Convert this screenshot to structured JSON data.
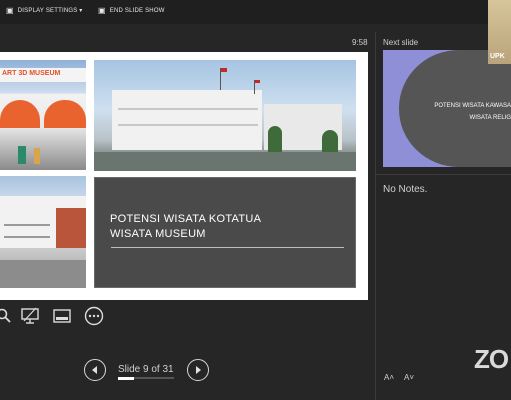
{
  "toolbar": {
    "display_settings_label": "DISPLAY SETTINGS ▾",
    "end_slideshow_label": "END SLIDE SHOW"
  },
  "timer": {
    "time": "9:58"
  },
  "slide": {
    "title_line1": "POTENSI WISATA KOTATUA",
    "title_line2": "WISATA MUSEUM",
    "photo_sign_text": "ART 3D MUSEUM"
  },
  "next_slide": {
    "header": "Next slide",
    "text_line1": "POTENSI WISATA KAWASA",
    "text_line2": "WISATA RELIG"
  },
  "notes": {
    "text": "No Notes."
  },
  "notes_font": {
    "increase": "A˄",
    "decrease": "A˅"
  },
  "navigation": {
    "counter": "Slide 9 of 31",
    "current": 9,
    "total": 31
  },
  "webcam": {
    "label": "UPK"
  },
  "branding": {
    "logo_text": "ZO"
  },
  "icons": {
    "tools": [
      "magnifier-icon",
      "presenter-screen-icon",
      "subtitles-icon",
      "more-options-icon"
    ],
    "nav": [
      "previous-slide-icon",
      "next-slide-icon"
    ]
  }
}
